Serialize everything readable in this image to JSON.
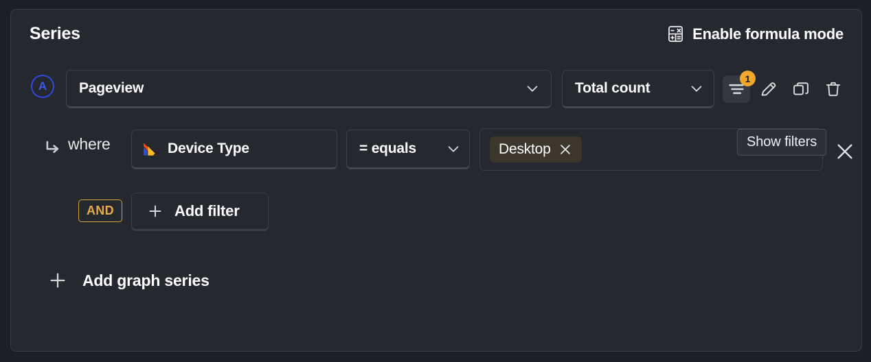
{
  "panel": {
    "title": "Series",
    "formula_mode": {
      "label": "Enable formula mode",
      "icon": "calculator-icon"
    }
  },
  "series": [
    {
      "letter": "A",
      "event": "Pageview",
      "math": "Total count",
      "actions": {
        "filters": {
          "icon": "filter-icon",
          "badge": "1",
          "tooltip": "Show filters"
        },
        "edit": {
          "icon": "pencil-icon"
        },
        "duplicate": {
          "icon": "copy-icon"
        },
        "delete": {
          "icon": "trash-icon"
        }
      },
      "filters": {
        "where_label": "where",
        "where_icon": "arrow-turn-down-right-icon",
        "rows": [
          {
            "property": "Device Type",
            "property_icon": "posthog-logo-icon",
            "operator": "= equals",
            "values": [
              "Desktop"
            ]
          }
        ],
        "logical_operator": "AND",
        "add_filter_label": "Add filter"
      }
    }
  ],
  "add_graph_series_label": "Add graph series",
  "colors": {
    "page_background": "#1d1f27",
    "panel_background": "#26282f",
    "panel_border": "#3a3d45",
    "series_letter": "#3f58ef",
    "badge_orange": "#f1a82c",
    "and_orange": "#e6ab4a",
    "chip_background": "#3d362b",
    "text_primary": "#ffffff",
    "tooltip_background": "#2d3039"
  }
}
